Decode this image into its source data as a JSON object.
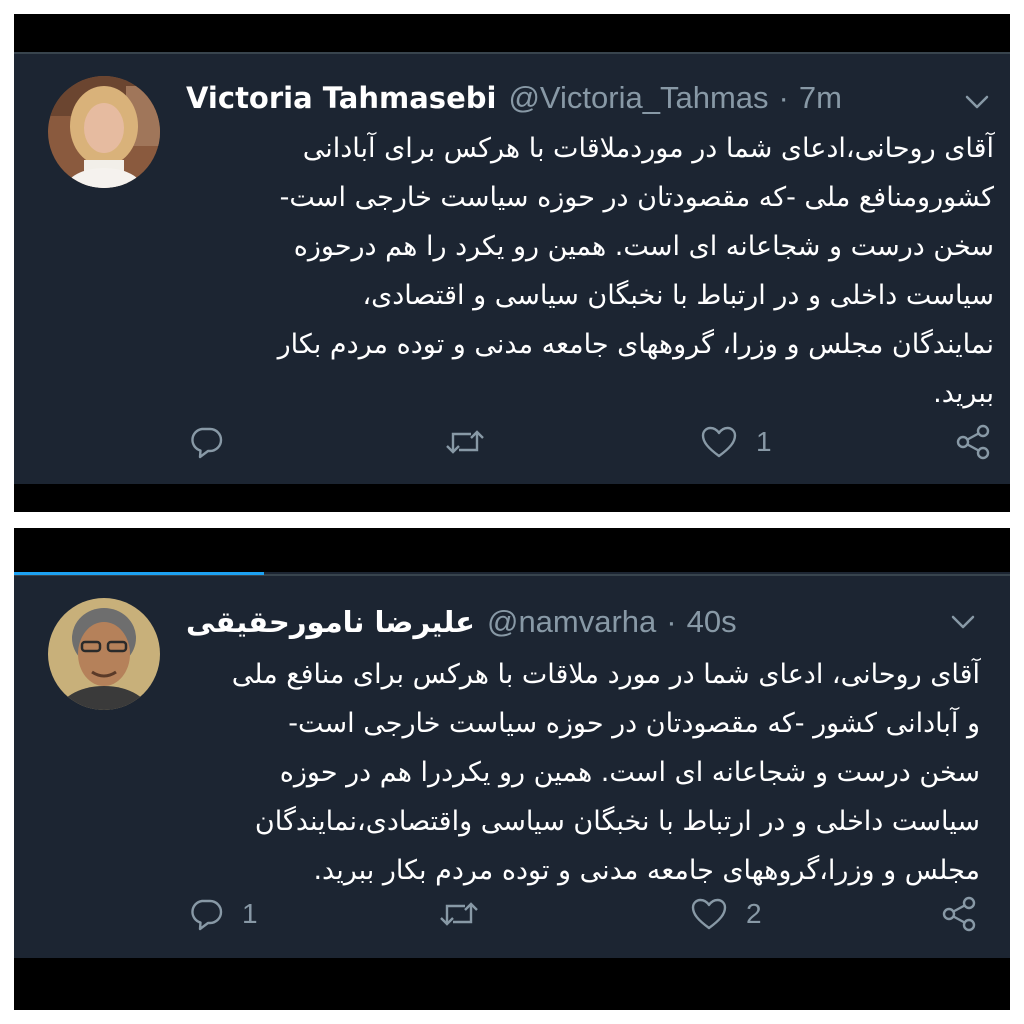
{
  "colors": {
    "background": "#1c2532",
    "text": "#ffffff",
    "muted": "#8899a6",
    "accent": "#1da1f2",
    "divider": "#38444d"
  },
  "tweets": [
    {
      "display_name": "Victoria Tahmasebi",
      "handle": "@Victoria_Tahmas",
      "separator": "·",
      "time": "7m",
      "avatar_icon": "profile-photo-woman",
      "menu_icon": "chevron-down-icon",
      "lines": [
        "آقای روحانی،ادعای شما در موردملاقات با هرکس برای آبادانی",
        "کشورومنافع ملی -که مقصودتان در حوزه سیاست خارجی است-",
        "سخن درست و شجاعانه ای است. همین رو یکرد را هم درحوزه",
        "سیاست داخلی و در ارتباط با نخبگان سیاسی و اقتصادی،",
        "نمایندگان مجلس و وزرا، گروههای جامعه مدنی و توده مردم بکار",
        "ببرید."
      ],
      "actions": {
        "reply_icon": "reply-icon",
        "reply_count": "",
        "retweet_icon": "retweet-icon",
        "like_icon": "heart-icon",
        "like_count": "1",
        "share_icon": "share-icon"
      }
    },
    {
      "display_name": "علیرضا نامورحقیقی",
      "handle": "@namvarha",
      "separator": "·",
      "time": "40s",
      "avatar_icon": "profile-photo-man",
      "menu_icon": "chevron-down-icon",
      "lines": [
        "آقای روحانی، ادعای شما در مورد ملاقات با هرکس برای منافع ملی",
        "و آبادانی کشور -که مقصودتان در حوزه سیاست خارجی است-",
        "سخن درست و شجاعانه ای است. همین رو یکردرا هم در حوزه",
        "سیاست داخلی و در ارتباط با نخبگان سیاسی واقتصادی،نمایندگان",
        "مجلس و وزرا،گروههای جامعه مدنی و توده مردم بکار ببرید."
      ],
      "actions": {
        "reply_icon": "reply-icon",
        "reply_count": "1",
        "retweet_icon": "retweet-icon",
        "like_icon": "heart-icon",
        "like_count": "2",
        "share_icon": "share-icon"
      }
    }
  ]
}
